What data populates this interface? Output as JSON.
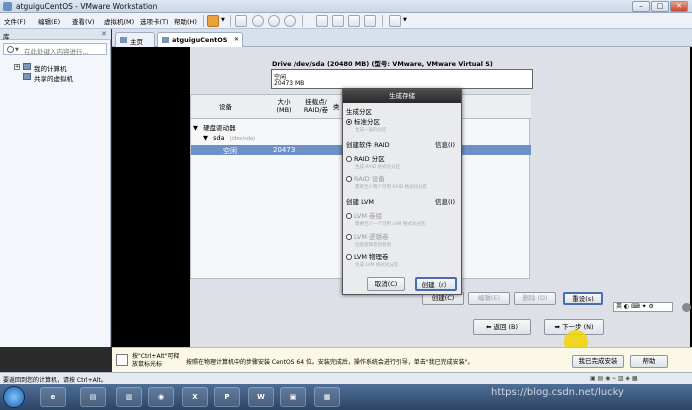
{
  "window": {
    "title": "atguiguCentOS - VMware Workstation"
  },
  "menu": [
    "文件(F)",
    "编辑(E)",
    "查看(V)",
    "虚拟机(M)",
    "选项卡(T)",
    "帮助(H)"
  ],
  "library": {
    "title": "库",
    "search_placeholder": "在此处键入内容进行...",
    "items": [
      {
        "label": "我的计算机"
      },
      {
        "label": "共享的虚拟机"
      }
    ]
  },
  "tabs": [
    {
      "label": "主页"
    },
    {
      "label": "atguiguCentOS"
    }
  ],
  "drive": {
    "title": "Drive /dev/sda (20480 MB) (型号: VMware, VMware Virtual S)",
    "free_label": "空闲",
    "free_size": "20473 MB"
  },
  "table": {
    "headers": [
      "设备",
      "大小\n(MB)",
      "挂载点/\nRAID/卷",
      "类"
    ],
    "rows": [
      {
        "toggle": "▼",
        "device": "硬盘驱动器"
      },
      {
        "toggle": "▼",
        "device": "sda",
        "path": "(/dev/sda)"
      },
      {
        "device": "空闲",
        "size": "20473"
      }
    ]
  },
  "buttons": {
    "create": "创建(C)",
    "edit": "编辑(E)",
    "delete": "删除 (D)",
    "reset": "重设(s)",
    "back": "返回 (B)",
    "next": "下一步 (N)"
  },
  "dialog": {
    "title": "生成存储",
    "sec_std": "生成分区",
    "opt_std": "标准分区",
    "desc_std": "生成一般的分区",
    "sec_raid": "创建软件 RAID",
    "info": "信息(I)",
    "opt_raid_part": "RAID 分区",
    "desc_raid_part": "生成 RAID 格式化分区",
    "opt_raid_dev": "RAID 设备",
    "desc_raid_dev": "需要至少两个可用 RAID 格式化分区",
    "sec_lvm": "创建 LVM",
    "opt_lvm_vg": "LVM 卷组",
    "desc_lvm_vg": "需要至少一个可用 LVM 格式化分区",
    "opt_lvm_lv": "LVM 逻辑卷",
    "desc_lvm_lv": "创建逻辑卷到卷组",
    "opt_lvm_pv": "LVM 物理卷",
    "desc_lvm_pv": "生成 LVM 格式化分区",
    "cancel": "取消(C)",
    "create": "创建（r）"
  },
  "hint": {
    "left_line1": "按\"Ctrl+Alt\"可释",
    "left_line2": "放鼠标光标",
    "middle": "按照在物理计算机中的步骤安装 CentOS 64 位。安装完成后，操作系统会进行引导，单击\"我已完成安装\"。",
    "done_button": "我已完成安装",
    "help_button": "帮助"
  },
  "status": {
    "text": "要返回到您的计算机，请按 Ctrl+Alt。"
  },
  "watermark": "https://blog.csdn.net/lucky"
}
